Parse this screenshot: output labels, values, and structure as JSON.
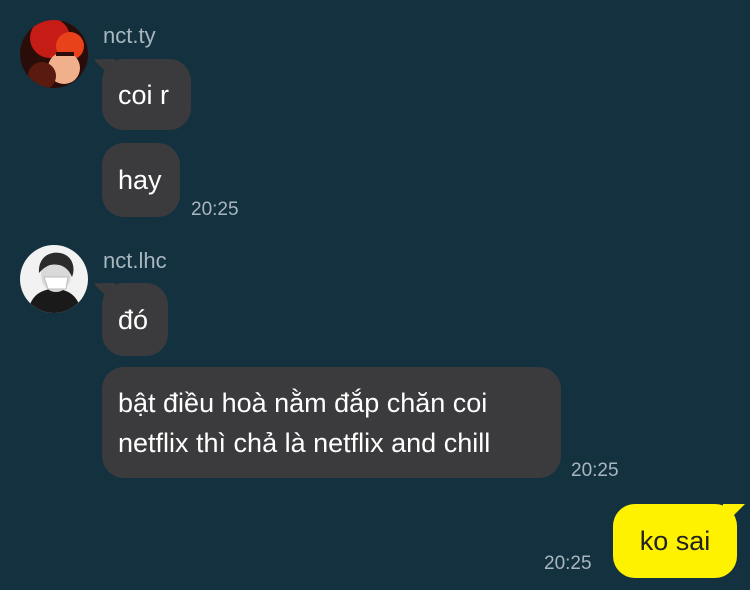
{
  "chat": {
    "messages": [
      {
        "sender": "nct.ty",
        "avatar": "user-avatar-red",
        "bubbles": [
          "coi r",
          "hay"
        ],
        "time": "20:25"
      },
      {
        "sender": "nct.lhc",
        "avatar": "user-avatar-masked",
        "bubbles": [
          "đó",
          "bật điều hoà nằm đắp chăn coi",
          "netflix thì chả là netflix and chill"
        ],
        "time": "20:25"
      },
      {
        "sender": "",
        "avatar": "",
        "bubbles": [
          "ko sai"
        ],
        "time": "20:25"
      }
    ]
  },
  "colors": {
    "background": "#13313f",
    "incoming_bubble": "#3b3b3d",
    "outgoing_bubble": "#fff200",
    "meta_text": "#a9b6bf"
  }
}
